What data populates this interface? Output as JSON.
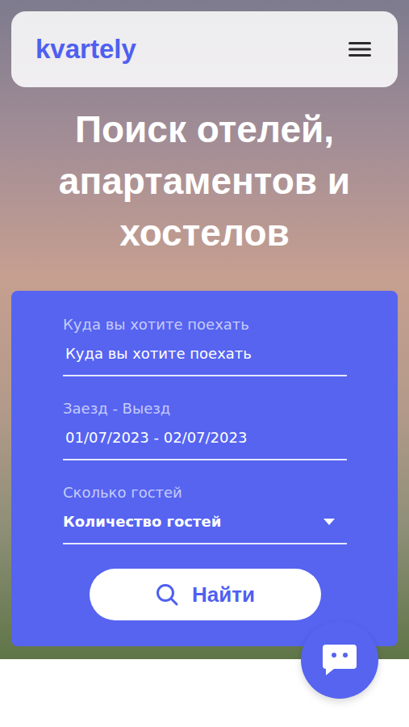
{
  "header": {
    "logo": "kvartely",
    "menu_open": false
  },
  "hero": {
    "title": "Поиск отелей, апартаментов и хостелов"
  },
  "search_form": {
    "fields": [
      {
        "label": "Куда вы хотите поехать",
        "text": "Куда вы хотите поехать",
        "kind": "text"
      },
      {
        "label": "Заезд - Выезд",
        "text": "01/07/2023 - 02/07/2023",
        "kind": "date"
      },
      {
        "label": "Сколько гостей",
        "text": "Количество гостей",
        "kind": "select"
      }
    ],
    "submit": "Найти"
  },
  "chat_button": {
    "open": false
  }
}
